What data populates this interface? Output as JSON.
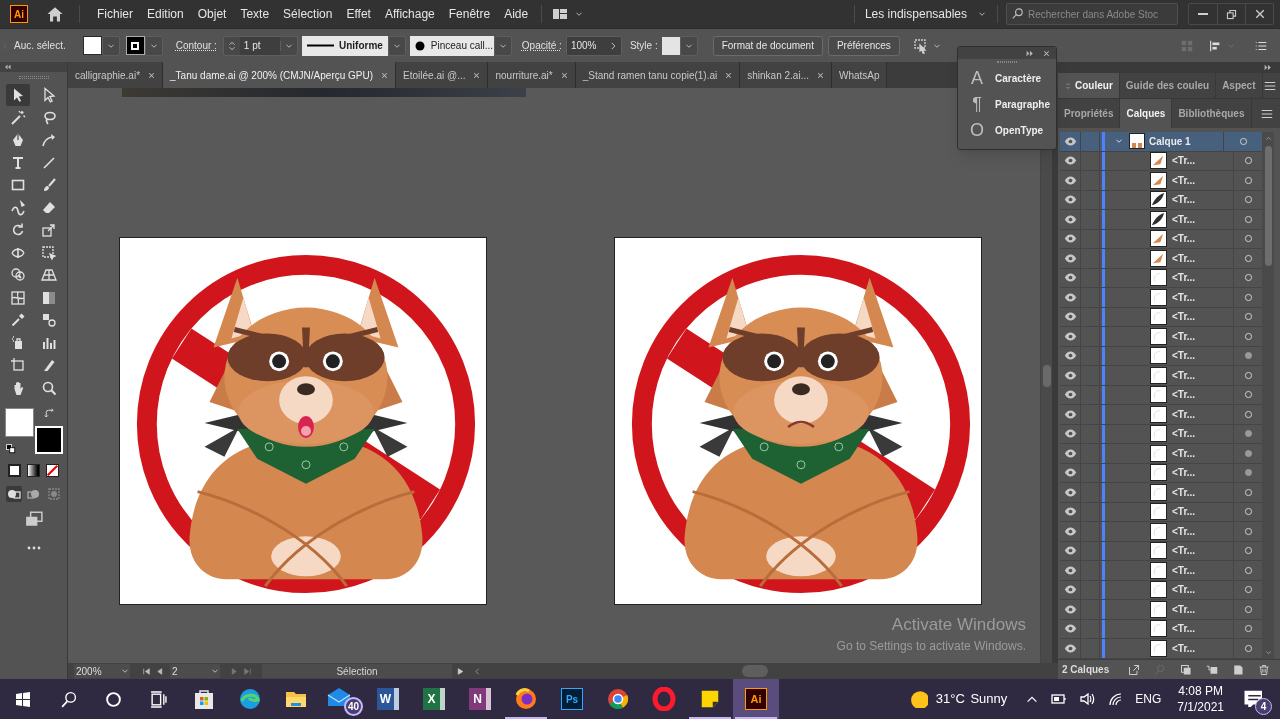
{
  "app": {
    "logo": "Ai"
  },
  "menu": [
    "Fichier",
    "Edition",
    "Objet",
    "Texte",
    "Sélection",
    "Effet",
    "Affichage",
    "Fenêtre",
    "Aide"
  ],
  "workspace": "Les indispensables",
  "search": {
    "placeholder": "Rechercher dans Adobe Stoc"
  },
  "control_bar": {
    "selection": "Auc. sélect.",
    "stroke_label": "Contour :",
    "stroke_weight": "1 pt",
    "profile": "Uniforme",
    "brush": "Pinceau call...",
    "opacity_label": "Opacité :",
    "opacity": "100%",
    "style_label": "Style :",
    "buttons": [
      "Format de document",
      "Préférences"
    ]
  },
  "doc_tabs": [
    {
      "label": "calligraphie.ai*",
      "selected": false
    },
    {
      "label": "_Tanu dame.ai @ 200% (CMJN/Aperçu GPU)",
      "selected": true
    },
    {
      "label": "Etoilée.ai @...",
      "selected": false
    },
    {
      "label": "nourriture.ai*",
      "selected": false
    },
    {
      "label": "_Stand ramen tanu copie(1).ai",
      "selected": false
    },
    {
      "label": "shinkan 2.ai...",
      "selected": false
    },
    {
      "label": "WhatsAp",
      "selected": false
    }
  ],
  "tools": [
    {
      "selected": true
    },
    {
      "selected": false
    },
    {
      "selected": false
    },
    {
      "selected": false
    },
    {
      "selected": false
    },
    {
      "selected": false
    },
    {
      "selected": false
    },
    {
      "selected": false
    },
    {
      "selected": false
    },
    {
      "selected": false
    },
    {
      "selected": false
    },
    {
      "selected": false
    },
    {
      "selected": false
    },
    {
      "selected": false
    },
    {
      "selected": false
    },
    {
      "selected": false
    },
    {
      "selected": false
    },
    {
      "selected": false
    },
    {
      "selected": false
    },
    {
      "selected": false
    },
    {
      "selected": false
    },
    {
      "selected": false
    },
    {
      "selected": false
    },
    {
      "selected": false
    },
    {
      "selected": false
    },
    {
      "selected": false
    },
    {
      "selected": false
    },
    {
      "selected": false
    }
  ],
  "float_panel": {
    "items": [
      {
        "icon": "A",
        "label": "Caractère"
      },
      {
        "icon": "¶",
        "label": "Paragraphe"
      },
      {
        "icon": "O",
        "label": "OpenType"
      }
    ]
  },
  "panel_tabs_top": [
    {
      "label": "Couleur",
      "selected": true
    },
    {
      "label": "Guide des couleu",
      "selected": false
    },
    {
      "label": "Aspect",
      "selected": false
    }
  ],
  "panel_tabs": [
    {
      "label": "Propriétés",
      "selected": false
    },
    {
      "label": "Calques",
      "selected": true
    },
    {
      "label": "Bibliothèques",
      "selected": false
    }
  ],
  "layers": [
    {
      "label": "Calque 1",
      "expanded": true,
      "selected": true,
      "children": [
        {
          "label": "<Tr...",
          "kind": "orange",
          "targeted": false,
          "selected": false
        },
        {
          "label": "<Tr...",
          "kind": "orange",
          "targeted": false,
          "selected": false
        },
        {
          "label": "<Tr...",
          "kind": "dark",
          "targeted": false,
          "selected": false
        },
        {
          "label": "<Tr...",
          "kind": "dark",
          "targeted": false,
          "selected": false
        },
        {
          "label": "<Tr...",
          "kind": "orange",
          "targeted": false,
          "selected": false
        },
        {
          "label": "<Tr...",
          "kind": "orange",
          "targeted": false,
          "selected": false
        },
        {
          "label": "<Tr...",
          "kind": "white",
          "targeted": false,
          "selected": false
        },
        {
          "label": "<Tr...",
          "kind": "white",
          "targeted": false,
          "selected": false
        },
        {
          "label": "<Tr...",
          "kind": "white",
          "targeted": false,
          "selected": false
        },
        {
          "label": "<Tr...",
          "kind": "white",
          "targeted": false,
          "selected": false
        },
        {
          "label": "<Tr...",
          "kind": "white",
          "targeted": true,
          "selected": false
        },
        {
          "label": "<Tr...",
          "kind": "white",
          "targeted": false,
          "selected": false
        },
        {
          "label": "<Tr...",
          "kind": "white",
          "targeted": false,
          "selected": false
        },
        {
          "label": "<Tr...",
          "kind": "white",
          "targeted": false,
          "selected": false
        },
        {
          "label": "<Tr...",
          "kind": "white",
          "targeted": true,
          "selected": false
        },
        {
          "label": "<Tr...",
          "kind": "white",
          "targeted": true,
          "selected": false
        },
        {
          "label": "<Tr...",
          "kind": "white",
          "targeted": true,
          "selected": false
        },
        {
          "label": "<Tr...",
          "kind": "white",
          "targeted": false,
          "selected": false
        },
        {
          "label": "<Tr...",
          "kind": "white",
          "targeted": false,
          "selected": false
        },
        {
          "label": "<Tr...",
          "kind": "white",
          "targeted": false,
          "selected": false
        },
        {
          "label": "<Tr...",
          "kind": "white",
          "targeted": false,
          "selected": false
        },
        {
          "label": "<Tr...",
          "kind": "white",
          "targeted": false,
          "selected": false
        },
        {
          "label": "<Tr...",
          "kind": "white",
          "targeted": false,
          "selected": false
        },
        {
          "label": "<Tr...",
          "kind": "white",
          "targeted": false,
          "selected": false
        },
        {
          "label": "<Tr...",
          "kind": "white",
          "targeted": false,
          "selected": false
        },
        {
          "label": "<Tr...",
          "kind": "white",
          "targeted": false,
          "selected": false
        }
      ]
    }
  ],
  "layers_footer": "2 Calques",
  "artboards": [
    {
      "kind": "open"
    },
    {
      "kind": "frown"
    }
  ],
  "status": {
    "zoom": "200%",
    "artboard": "2",
    "tool": "Sélection"
  },
  "activation": [
    "Activate Windows",
    "Go to Settings to activate Windows."
  ],
  "taskbar": {
    "apps": [
      {
        "kind": "store",
        "running": false,
        "selected": false
      },
      {
        "kind": "edge",
        "running": false,
        "selected": false
      },
      {
        "kind": "folder",
        "running": false,
        "selected": false
      },
      {
        "kind": "mail",
        "badge": "40",
        "running": false,
        "selected": false
      },
      {
        "kind": "word",
        "label": "W",
        "running": false,
        "selected": false
      },
      {
        "kind": "excel",
        "label": "X",
        "running": false,
        "selected": false
      },
      {
        "kind": "onenote",
        "label": "N",
        "running": false,
        "selected": false
      },
      {
        "kind": "firefox",
        "running": true,
        "selected": false
      },
      {
        "kind": "photoshop",
        "label": "Ps",
        "running": false,
        "selected": false
      },
      {
        "kind": "chrome",
        "running": false,
        "selected": false
      },
      {
        "kind": "opera",
        "running": false,
        "selected": false
      },
      {
        "kind": "sticky",
        "running": true,
        "selected": false
      },
      {
        "kind": "illustrator",
        "label": "Ai",
        "running": true,
        "selected": true
      }
    ],
    "weather": {
      "temp": "31°C",
      "condition": "Sunny"
    },
    "language": "ENG",
    "time": "4:08 PM",
    "date": "7/1/2021",
    "notifications": "4"
  }
}
